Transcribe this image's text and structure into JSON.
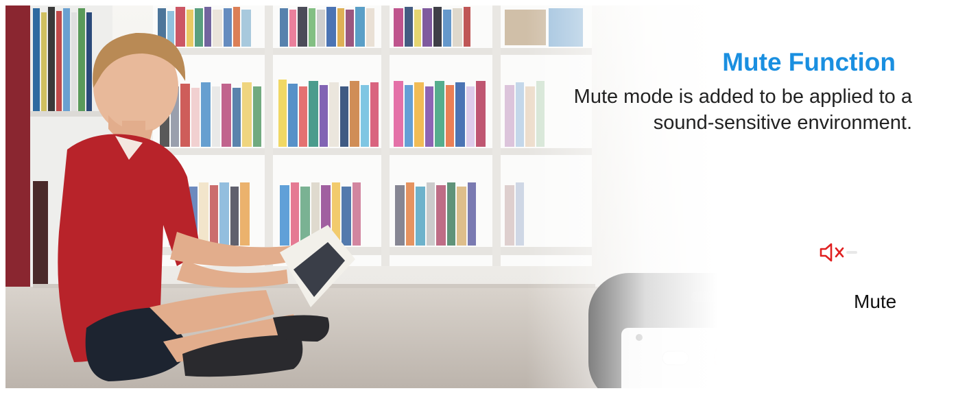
{
  "banner": {
    "title": "Mute Function",
    "description_line1": "Mute mode is added to be applied to a",
    "description_line2": "sound-sensitive environment.",
    "mute_label": "Mute"
  },
  "colors": {
    "title_blue": "#1a8fe0",
    "accent_red": "#e02020",
    "shirt_red": "#b8232a",
    "device_black": "#1c1c1c"
  },
  "icons": [
    "speaker-muted-icon",
    "dashed-callout-line",
    "mute-slide-switch"
  ]
}
